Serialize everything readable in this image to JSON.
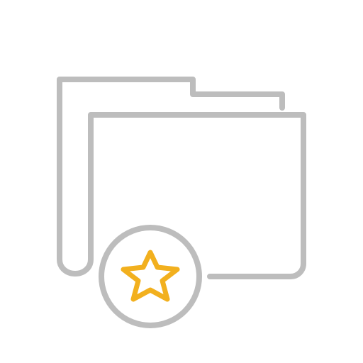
{
  "icon": {
    "name": "favorite-folder-icon",
    "parts": {
      "folder": "folder-icon",
      "badge": "circle-badge",
      "star": "star-icon"
    },
    "colors": {
      "outline": "#bdbdbd",
      "star": "#f2b01e",
      "background": "#ffffff"
    }
  }
}
